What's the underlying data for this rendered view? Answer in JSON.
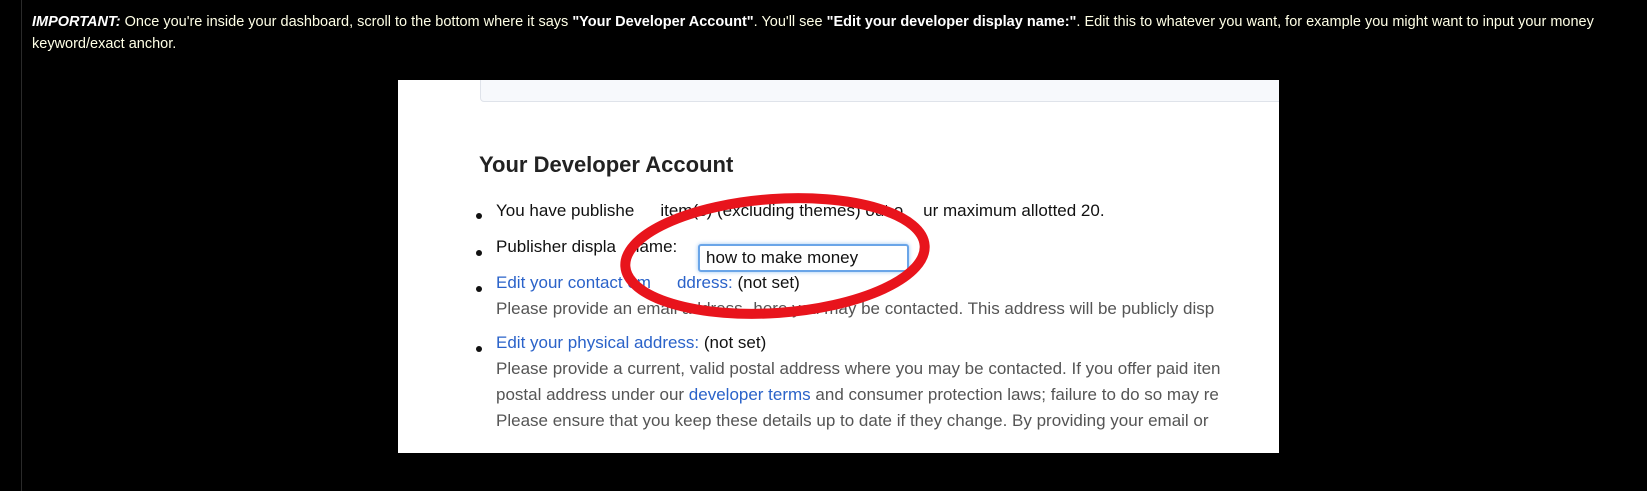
{
  "instructions": {
    "important_label": "IMPORTANT:",
    "text_1": " Once you're inside your dashboard, scroll to the bottom where it says ",
    "bold_1": "\"Your Developer Account\"",
    "text_2": ". You'll see ",
    "bold_2": "\"Edit your developer display name:\"",
    "text_3": ". Edit this to whatever you want, for example you might want to input your money keyword/exact anchor."
  },
  "screenshot": {
    "heading": "Your Developer Account",
    "item_published": {
      "before": "You have publishe",
      "after": "item(s) (excluding themes) out o",
      "end": "ur maximum allotted 20."
    },
    "item_display_name": {
      "label_a": "Publisher displa",
      "label_b": "name:",
      "input_value": "how to make money"
    },
    "item_contact": {
      "link_a": "Edit your contact em",
      "link_b": "ddress:",
      "status": "(not set)",
      "desc_a": "Please provide an email address ",
      "desc_b": "here you may be contacted. This address will be publicly disp"
    },
    "item_physical": {
      "link": "Edit your physical address:",
      "status": "(not set)",
      "desc_1": "Please provide a current, valid postal address where you may be contacted. If you offer paid iten",
      "desc_2_a": "postal address under our ",
      "desc_2_link": "developer terms",
      "desc_2_b": " and consumer protection laws; failure to do so may re",
      "desc_3": "Please ensure that you keep these details up to date if they change. By providing your email or"
    },
    "highlight_color": "#e8141c",
    "link_color": "#2a62c9"
  }
}
